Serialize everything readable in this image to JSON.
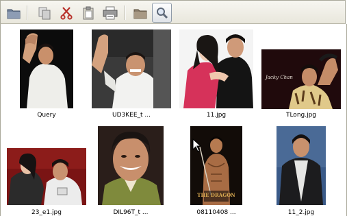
{
  "toolbar": {
    "buttons": [
      {
        "icon": "folder-icon"
      },
      {
        "icon": "copy-icon"
      },
      {
        "icon": "cut-icon"
      },
      {
        "icon": "paste-icon"
      },
      {
        "icon": "print-icon"
      },
      {
        "icon": "folder-icon"
      },
      {
        "icon": "search-icon",
        "active": true
      }
    ]
  },
  "gallery": {
    "items": [
      {
        "caption": "Query"
      },
      {
        "caption": "UD3KEE_t ..."
      },
      {
        "caption": "11.jpg"
      },
      {
        "caption": "TLong.jpg",
        "overlay_text": "Jacky Chan"
      },
      {
        "caption": "23_e1.jpg"
      },
      {
        "caption": "DIL96T_t ..."
      },
      {
        "caption": "08110408 ...",
        "overlay_text": "THE DRAGON"
      },
      {
        "caption": "11_2.jpg"
      }
    ]
  },
  "colors": {
    "toolbar_bg": "#ece9d8",
    "accent": "#316ac5"
  }
}
